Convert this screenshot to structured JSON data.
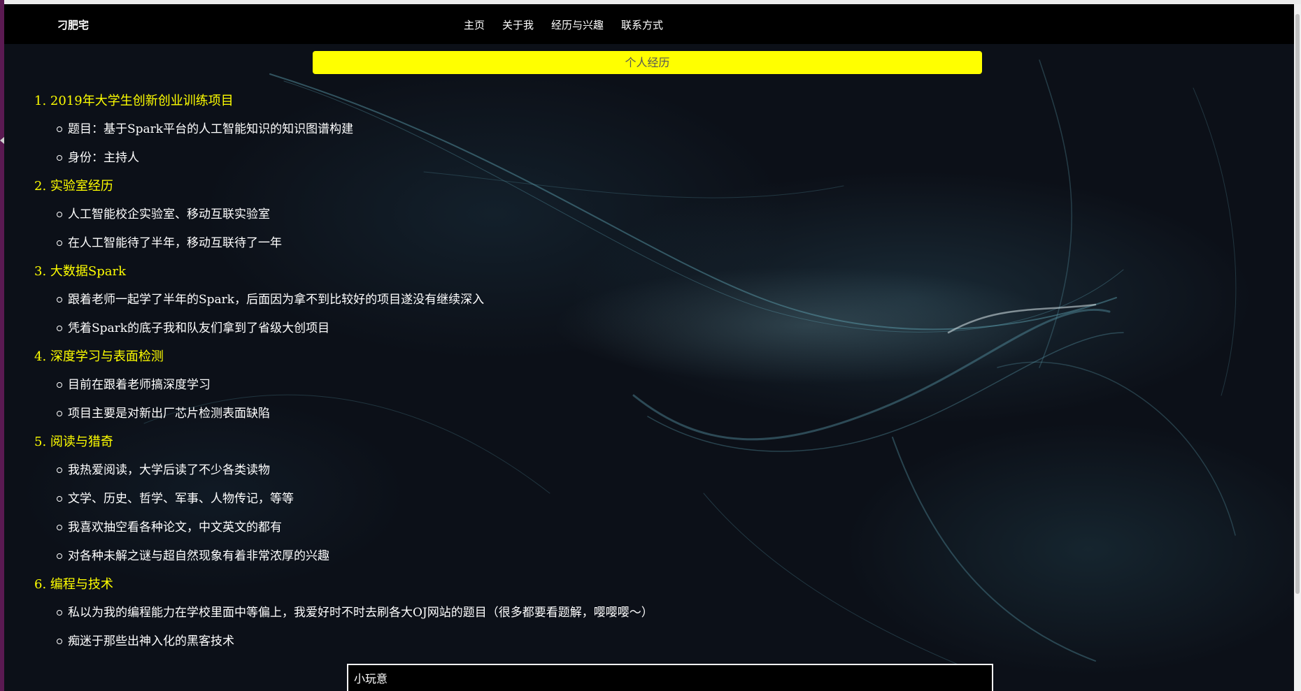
{
  "navbar": {
    "brand": "刁肥宅",
    "links": [
      "主页",
      "关于我",
      "经历与兴趣",
      "联系方式"
    ]
  },
  "banner": {
    "title": "个人经历"
  },
  "sections": [
    {
      "title": "1. 2019年大学生创新创业训练项目",
      "items": [
        "题目：基于Spark平台的人工智能知识的知识图谱构建",
        "身份：主持人"
      ]
    },
    {
      "title": "2. 实验室经历",
      "items": [
        "人工智能校企实验室、移动互联实验室",
        "在人工智能待了半年，移动互联待了一年"
      ]
    },
    {
      "title": "3. 大数据Spark",
      "items": [
        "跟着老师一起学了半年的Spark，后面因为拿不到比较好的项目遂没有继续深入",
        "凭着Spark的底子我和队友们拿到了省级大创项目"
      ]
    },
    {
      "title": "4. 深度学习与表面检测",
      "items": [
        "目前在跟着老师搞深度学习",
        "项目主要是对新出厂芯片检测表面缺陷"
      ]
    },
    {
      "title": "5. 阅读与猎奇",
      "items": [
        "我热爱阅读，大学后读了不少各类读物",
        "文学、历史、哲学、军事、人物传记，等等",
        "我喜欢抽空看各种论文，中文英文的都有",
        "对各种未解之谜与超自然现象有着非常浓厚的兴趣"
      ]
    },
    {
      "title": "6. 编程与技术",
      "items": [
        "私以为我的编程能力在学校里面中等偏上，我爱好时不时去刷各大OJ网站的题目（很多都要看题解，嘤嘤嘤～）",
        "痴迷于那些出神入化的黑客技术"
      ]
    }
  ],
  "footer": {
    "label": "小玩意"
  },
  "colors": {
    "accent": "#ffff00",
    "navbar_bg": "#000000",
    "text": "#ffffff"
  }
}
